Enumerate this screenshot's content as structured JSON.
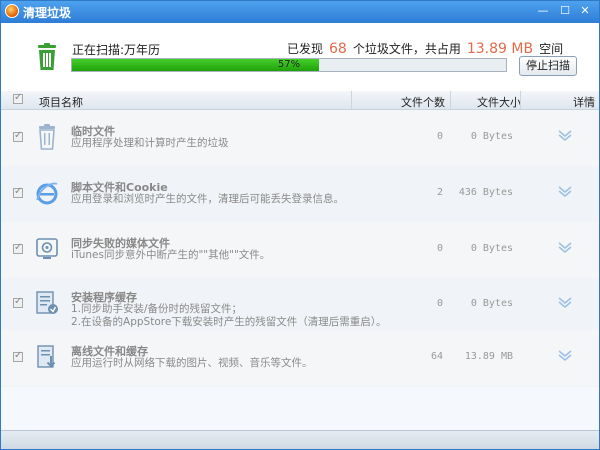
{
  "window": {
    "title": "清理垃圾"
  },
  "scan": {
    "status_label": "正在扫描:万年历",
    "found_prefix": "已发现",
    "found_count": "68",
    "found_middle": "个垃圾文件，共占用",
    "found_size": "13.89 MB",
    "found_suffix": "空间",
    "progress_percent": 57,
    "progress_text": "57%",
    "stop_button": "停止扫描"
  },
  "table": {
    "headers": {
      "name": "项目名称",
      "count": "文件个数",
      "size": "文件大小",
      "detail": "详情"
    },
    "rows": [
      {
        "icon": "trash-icon",
        "title": "临时文件",
        "desc": "应用程序处理和计算时产生的垃圾",
        "count": "0",
        "size": "0 Bytes"
      },
      {
        "icon": "ie-browser-icon",
        "title": "脚本文件和Cookie",
        "desc": "应用登录和浏览时产生的文件，清理后可能丢失登录信息。",
        "count": "2",
        "size": "436 Bytes"
      },
      {
        "icon": "media-sync-icon",
        "title": "同步失败的媒体文件",
        "desc": "iTunes同步意外中断产生的\"\"其他\"\"文件。",
        "count": "0",
        "size": "0 Bytes"
      },
      {
        "icon": "installer-cache-icon",
        "title": "安装程序缓存",
        "desc_lines": [
          "1.同步助手安装/备份时的残留文件；",
          "2.在设备的AppStore下载安装时产生的残留文件（清理后需重启）。"
        ],
        "count": "0",
        "size": "0 Bytes"
      },
      {
        "icon": "offline-download-icon",
        "title": "离线文件和缓存",
        "desc": "应用运行时从网络下载的图片、视频、音乐等文件。",
        "count": "64",
        "size": "13.89 MB"
      }
    ]
  },
  "colors": {
    "accent": "#2f7dd6",
    "progress": "#2fb515",
    "highlight": "#e26a4a"
  }
}
